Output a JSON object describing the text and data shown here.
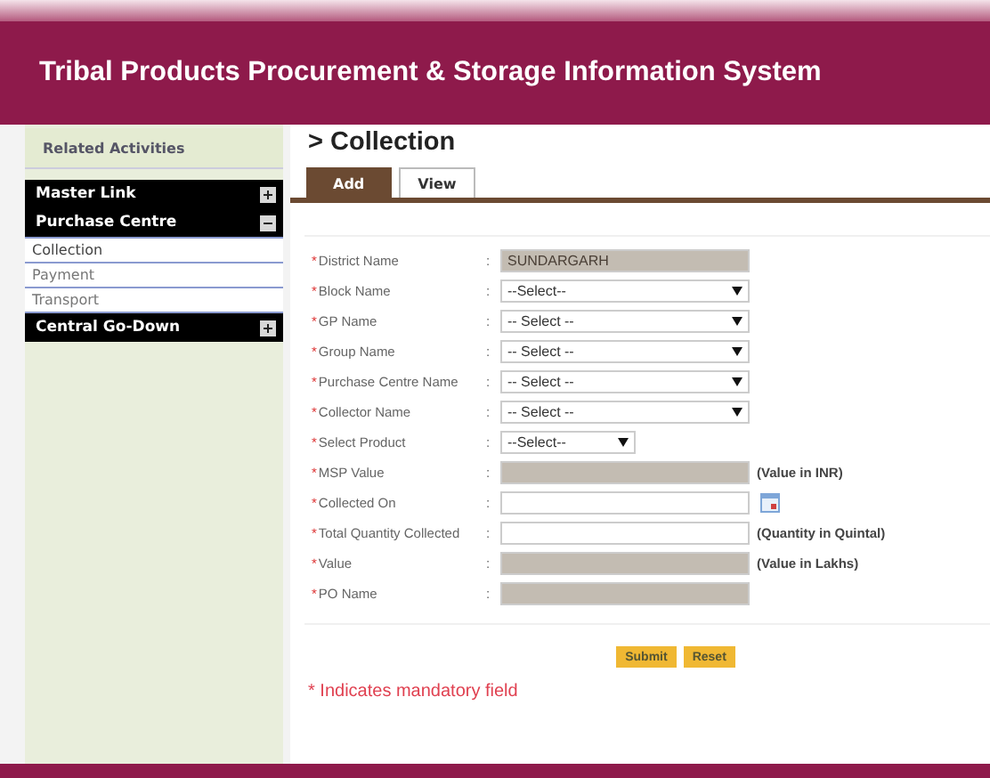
{
  "header": {
    "title": "Tribal Products Procurement & Storage Information System"
  },
  "sidebar": {
    "heading": "Related Activities",
    "groups": [
      {
        "label": "Master Link",
        "expanded": false
      },
      {
        "label": "Purchase Centre",
        "expanded": true,
        "children": [
          {
            "label": "Collection",
            "selected": true
          },
          {
            "label": "Payment",
            "selected": false
          },
          {
            "label": "Transport",
            "selected": false
          }
        ]
      },
      {
        "label": "Central Go-Down",
        "expanded": false
      }
    ]
  },
  "page": {
    "title": "> Collection"
  },
  "tabs": [
    {
      "label": "Add",
      "selected": true
    },
    {
      "label": "View",
      "selected": false
    }
  ],
  "form": {
    "fields": [
      {
        "mark": "*",
        "label": "District Name",
        "sep": ":",
        "kind": "readonly",
        "value": "SUNDARGARH"
      },
      {
        "mark": "*",
        "label": "Block Name",
        "sep": ":",
        "kind": "select",
        "value": "--Select--"
      },
      {
        "mark": "*",
        "label": "GP Name",
        "sep": ":",
        "kind": "select",
        "value": "-- Select --"
      },
      {
        "mark": "*",
        "label": "Group Name",
        "sep": ":",
        "kind": "select",
        "value": "-- Select --"
      },
      {
        "mark": "*",
        "label": "Purchase Centre Name",
        "sep": ":",
        "kind": "select",
        "value": "-- Select --"
      },
      {
        "mark": "*",
        "label": "Collector Name",
        "sep": ":",
        "kind": "select",
        "value": "-- Select --"
      },
      {
        "mark": "*",
        "label": "Select Product",
        "sep": ":",
        "kind": "select-short",
        "value": "--Select--"
      },
      {
        "mark": "*",
        "label": "MSP Value",
        "sep": ":",
        "kind": "readonly",
        "note": "(Value in INR)"
      },
      {
        "mark": "*",
        "label": "Collected On",
        "sep": ":",
        "kind": "date"
      },
      {
        "mark": "*",
        "label": "Total Quantity Collected",
        "sep": ":",
        "kind": "text",
        "note": "(Quantity in Quintal)"
      },
      {
        "mark": "*",
        "label": "Value",
        "sep": ":",
        "kind": "readonly",
        "note": "(Value in Lakhs)"
      },
      {
        "mark": "*",
        "label": "PO Name",
        "sep": ":",
        "kind": "readonly"
      }
    ],
    "buttons": [
      "Submit",
      "Reset"
    ],
    "footnote": "* Indicates mandatory field"
  }
}
